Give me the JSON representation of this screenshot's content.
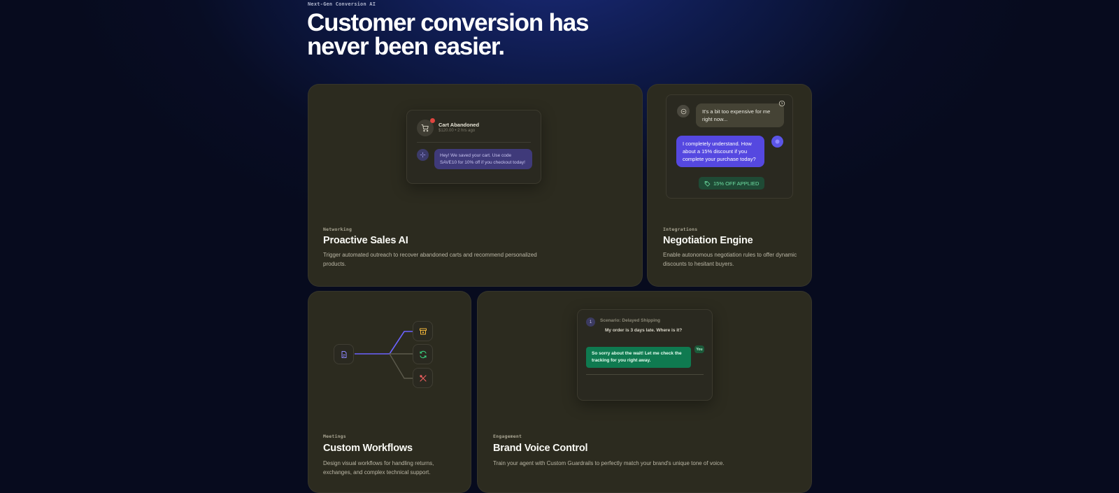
{
  "hero": {
    "eyebrow": "Next-Gen Conversion AI",
    "title_line1": "Customer conversion has",
    "title_line2": "never been easier."
  },
  "cards": {
    "sales": {
      "tag": "Networking",
      "title": "Proactive Sales AI",
      "desc": "Trigger automated outreach to recover abandoned carts and recommend personalized products.",
      "widget": {
        "event_title": "Cart Abandoned",
        "event_meta": "$120.00 • 2 hrs ago",
        "message": "Hey! We saved your cart. Use code SAVE10 for 10% off if you checkout today!"
      }
    },
    "negotiation": {
      "tag": "Integrations",
      "title": "Negotiation Engine",
      "desc": "Enable autonomous negotiation rules to offer dynamic discounts to hesitant buyers.",
      "widget": {
        "user_message": "It's a bit too expensive for me right now...",
        "agent_message": "I completely understand. How about a 15% discount if you complete your purchase today?",
        "badge": "15% OFF APPLIED"
      }
    },
    "workflows": {
      "tag": "Meetings",
      "title": "Custom Workflows",
      "desc": "Design visual workflows for handling returns, exchanges, and complex technical support."
    },
    "voice": {
      "tag": "Engagement",
      "title": "Brand Voice Control",
      "desc": "Train your agent with Custom Guardrails to perfectly match your brand's unique tone of voice.",
      "widget": {
        "scenario_index": "1",
        "scenario_title": "Scenario: Delayed Shipping",
        "customer_message": "My order is 3 days late. Where is it?",
        "reply_label": "You",
        "reply": "So sorry about the wait! Let me check the tracking for you right away."
      }
    }
  },
  "colors": {
    "background": "#070b1e",
    "card": "#2c2b1f",
    "accent_purple": "#5548e0",
    "accent_green": "#0f7a50",
    "workflow_line_active": "#6b63ff"
  },
  "icons": [
    "cart-icon",
    "sparkle-icon",
    "user-icon",
    "clock-icon",
    "bot-icon",
    "tag-icon",
    "document-icon",
    "archive-icon",
    "refresh-icon",
    "tools-icon"
  ]
}
